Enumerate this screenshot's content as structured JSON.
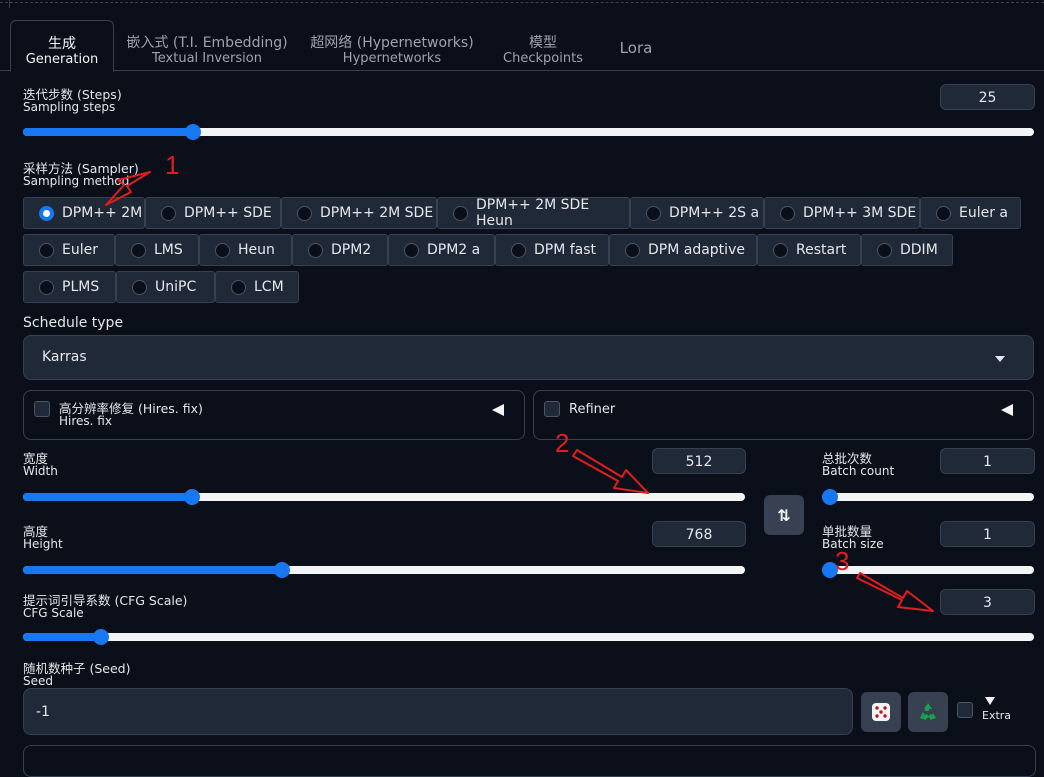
{
  "tabs": [
    {
      "line1": "生成",
      "line2": "Generation",
      "active": true
    },
    {
      "line1": "嵌入式 (T.I. Embedding)",
      "line2": "Textual Inversion"
    },
    {
      "line1": "超网络 (Hypernetworks)",
      "line2": "Hypernetworks"
    },
    {
      "line1": "模型",
      "line2": "Checkpoints"
    },
    {
      "line1": "Lora",
      "line2": ""
    }
  ],
  "steps": {
    "label_cn": "迭代步数 (Steps)",
    "label_en": "Sampling steps",
    "value": "25",
    "fraction": 0.16
  },
  "sampler": {
    "label_cn": "采样方法 (Sampler)",
    "label_en": "Sampling method",
    "selected": "DPM++ 2M",
    "options": [
      "DPM++ 2M",
      "DPM++ SDE",
      "DPM++ 2M SDE",
      "DPM++ 2M SDE Heun",
      "DPM++ 2S a",
      "DPM++ 3M SDE",
      "Euler a",
      "Euler",
      "LMS",
      "Heun",
      "DPM2",
      "DPM2 a",
      "DPM fast",
      "DPM adaptive",
      "Restart",
      "DDIM",
      "PLMS",
      "UniPC",
      "LCM"
    ]
  },
  "schedule": {
    "label": "Schedule type",
    "value": "Karras"
  },
  "hires": {
    "label_cn": "高分辨率修复 (Hires. fix)",
    "label_en": "Hires. fix"
  },
  "refiner": {
    "label": "Refiner"
  },
  "width": {
    "label_cn": "宽度",
    "label_en": "Width",
    "value": "512",
    "fraction": 0.23
  },
  "height": {
    "label_cn": "高度",
    "label_en": "Height",
    "value": "768",
    "fraction": 0.36
  },
  "batch_count": {
    "label_cn": "总批次数",
    "label_en": "Batch count",
    "value": "1",
    "fraction": 0.0
  },
  "batch_size": {
    "label_cn": "单批数量",
    "label_en": "Batch size",
    "value": "1",
    "fraction": 0.0
  },
  "cfg": {
    "label_cn": "提示词引导系数 (CFG Scale)",
    "label_en": "CFG Scale",
    "value": "3",
    "fraction": 0.07
  },
  "seed": {
    "label_cn": "随机数种子 (Seed)",
    "label_en": "Seed",
    "value": "-1",
    "extra_label": "Extra"
  },
  "swap_icon": "swap-vertical-arrows-icon",
  "annotations": [
    "1",
    "2",
    "3"
  ],
  "colors": {
    "accent": "#1877f2",
    "annotation": "#e11d1d",
    "background": "#0b0f19",
    "panel": "#1f2937"
  }
}
